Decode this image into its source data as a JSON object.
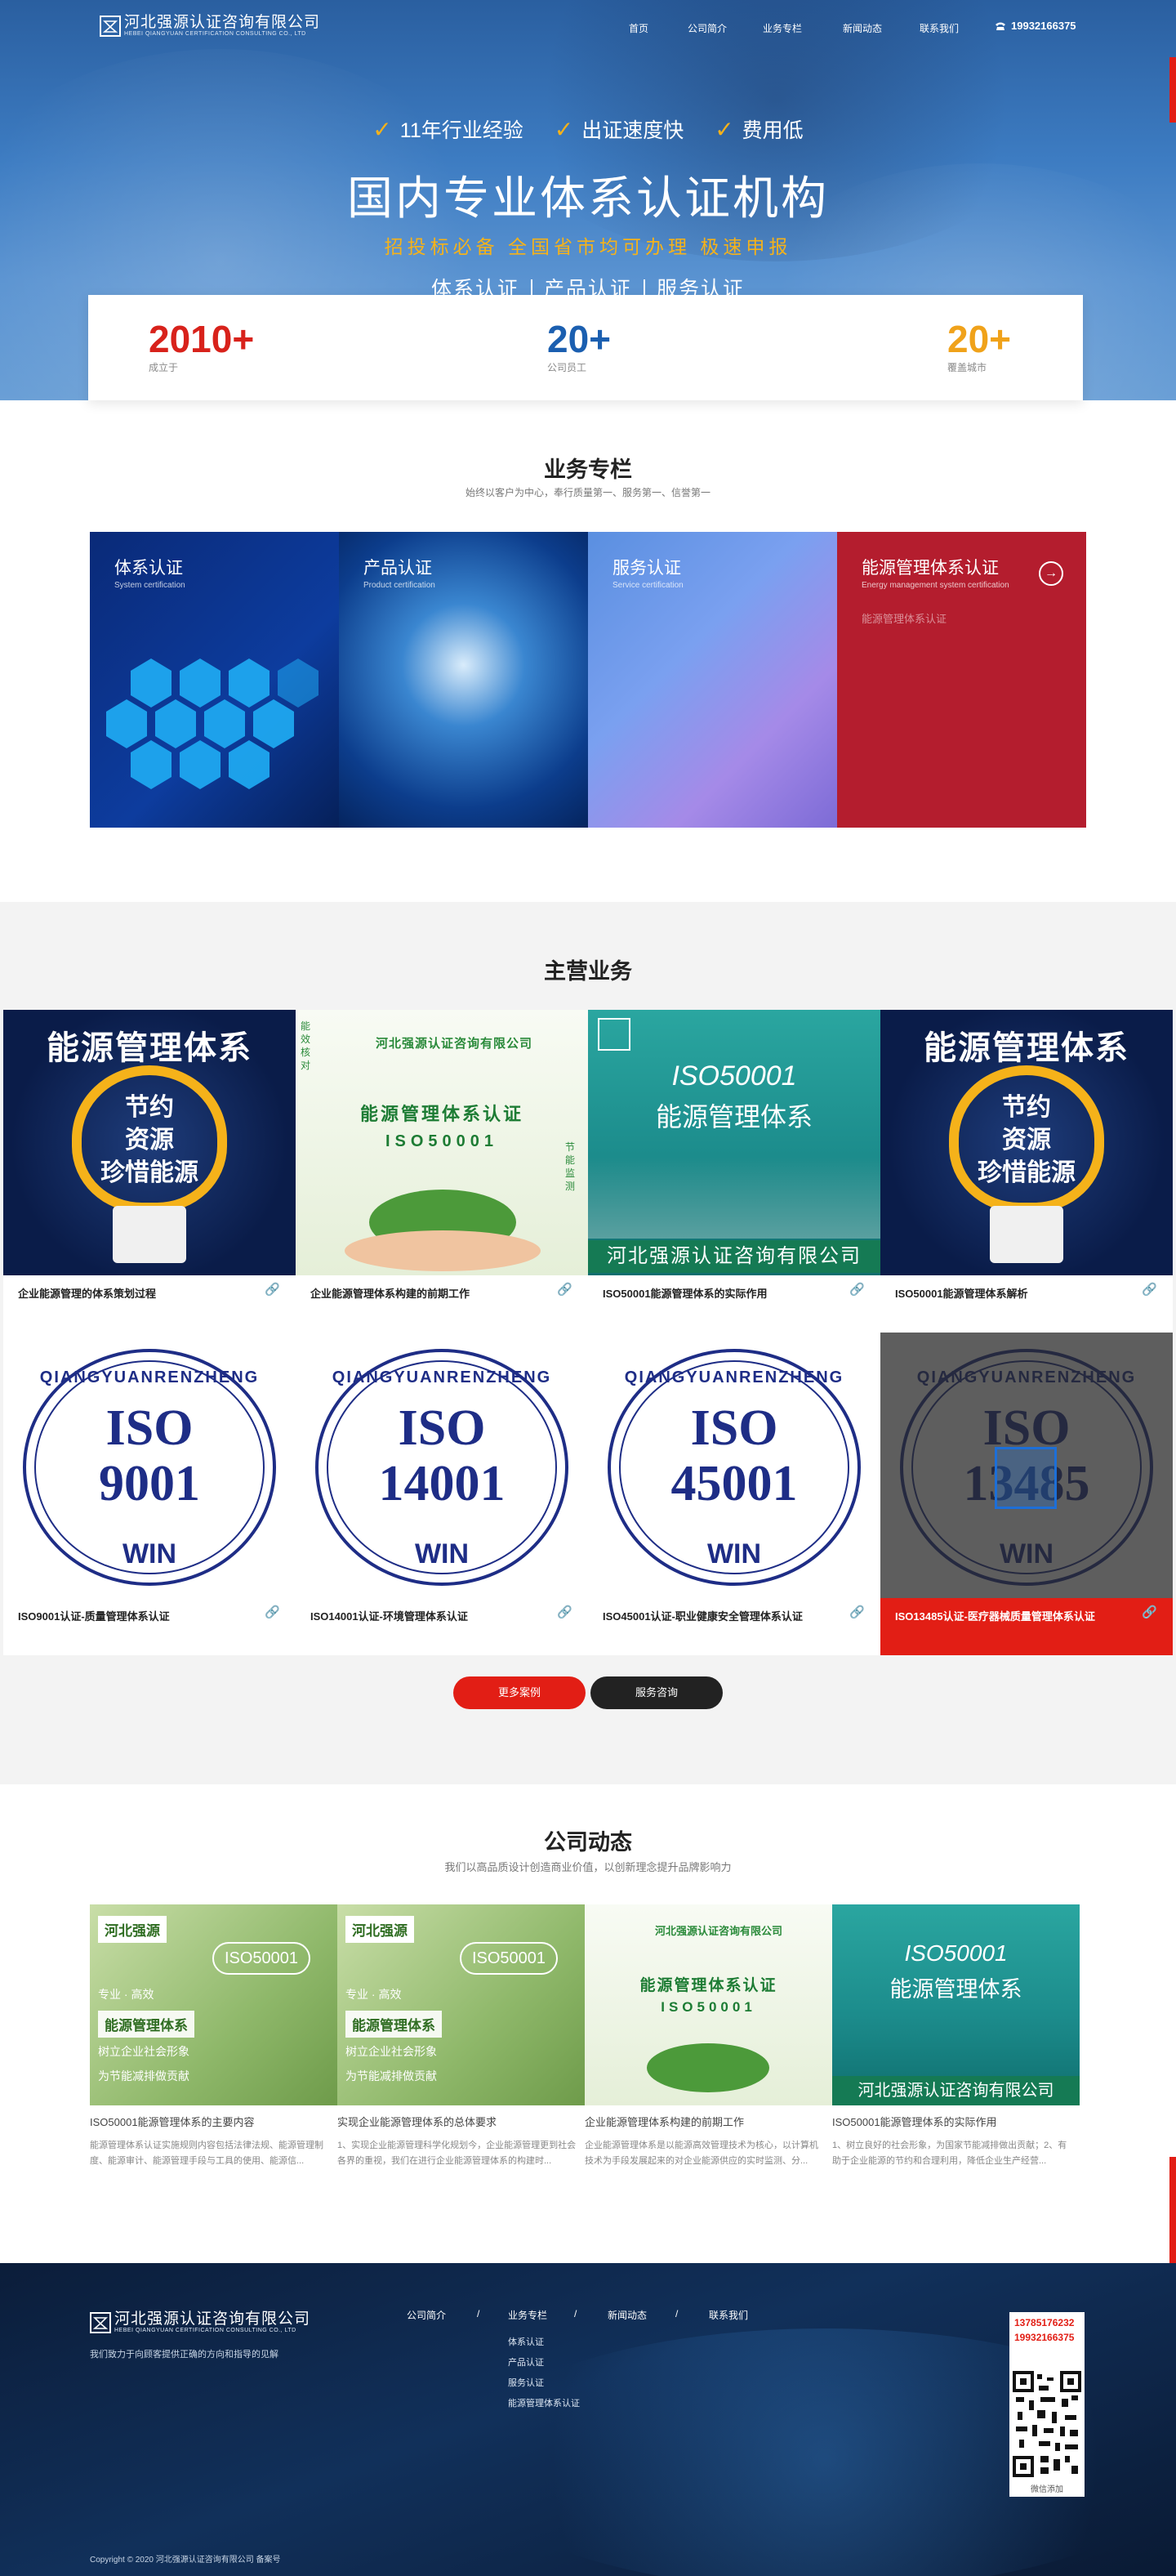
{
  "header": {
    "logo_cn": "河北强源认证咨询有限公司",
    "logo_en": "HEBEI QIANGYUAN CERTIFICATION CONSULTING CO., LTD",
    "nav": [
      "首页",
      "公司简介",
      "业务专栏",
      "新闻动态",
      "联系我们"
    ],
    "phone": "19932166375",
    "phone_icon": "phone-icon"
  },
  "hero": {
    "features": [
      "11年行业经验",
      "出证速度快",
      "费用低"
    ],
    "title": "国内专业体系认证机构",
    "subtitle": "招投标必备  全国省市均可办理  极速申报",
    "cats": [
      "体系认证",
      "产品认证",
      "服务认证"
    ]
  },
  "stats": [
    {
      "num": "2010",
      "plus": "+",
      "label": "成立于",
      "color": "#d8221b"
    },
    {
      "num": "20",
      "plus": "+",
      "label": "公司员工",
      "color": "#1b5fb0"
    },
    {
      "num": "20",
      "plus": "+",
      "label": "覆盖城市",
      "color": "#f0a21a"
    }
  ],
  "business": {
    "title": "业务专栏",
    "subtitle": "始终以客户为中心，奉行质量第一、服务第一、信誉第一",
    "tiles": [
      {
        "title": "体系认证",
        "en": "System certification"
      },
      {
        "title": "产品认证",
        "en": "Product certification"
      },
      {
        "title": "服务认证",
        "en": "Service certification"
      },
      {
        "title": "能源管理体系认证",
        "en": "Energy management system certification",
        "text": "能源管理体系认证"
      }
    ]
  },
  "main": {
    "title": "主营业务",
    "cards": [
      {
        "caption": "企业能源管理的体系策划过程"
      },
      {
        "caption": "企业能源管理体系构建的前期工作"
      },
      {
        "caption": "ISO50001能源管理体系的实际作用"
      },
      {
        "caption": "ISO50001能源管理体系解析"
      },
      {
        "caption": "ISO9001认证-质量管理体系认证"
      },
      {
        "caption": "ISO14001认证-环境管理体系认证"
      },
      {
        "caption": "ISO45001认证-职业健康安全管理体系认证"
      },
      {
        "caption": "ISO13485认证-医疗器械质量管理体系认证"
      }
    ],
    "img_text": {
      "bulb_title": "能源管理体系",
      "bulb_l1": "节约",
      "bulb_l2": "资源",
      "bulb_l3": "珍惜能源",
      "house_company": "河北强源认证咨询有限公司",
      "house_t1": "能源管理体系认证",
      "house_t2": "ISO50001",
      "house_side": "能效核对",
      "house_side2": "节能监测",
      "city_t1": "ISO50001",
      "city_t2": "能源管理体系",
      "city_company": "河北强源认证咨询有限公司",
      "iso_arc": "QIANGYUANRENZHENG",
      "iso_word": "ISO",
      "iso_codes": [
        "9001",
        "14001",
        "45001",
        "13485"
      ],
      "iso_win": "WIN"
    },
    "btn_more": "更多案例",
    "btn_consult": "服务咨询"
  },
  "news": {
    "title": "公司动态",
    "subtitle": "我们以高品质设计创造商业价值，以创新理念提升品牌影响力",
    "items": [
      {
        "title": "ISO50001能源管理体系的主要内容",
        "desc": "能源管理体系认证实施规则内容包括法律法规、能源管理制度、能源审计、能源管理手段与工具的使用、能源信..."
      },
      {
        "title": "实现企业能源管理体系的总体要求",
        "desc": "1、实现企业能源管理科学化规划今，企业能源管理更到社会各界的重视，我们在进行企业能源管理体系的构建时..."
      },
      {
        "title": "企业能源管理体系构建的前期工作",
        "desc": "企业能源管理体系是以能源高效管理技术为核心，以计算机技术为手段发展起来的对企业能源供应的实时监测、分..."
      },
      {
        "title": "ISO50001能源管理体系的实际作用",
        "desc": "1、树立良好的社会形象，为国家节能减排做出贡献；2、有助于企业能源的节约和合理利用，降低企业生产经营..."
      }
    ],
    "img_text": {
      "green_company": "河北强源",
      "green_t1": "ISO50001",
      "green_t2": "专业 · 高效",
      "green_t3": "能源管理体系",
      "green_t4": "树立企业社会形象",
      "green_t5": "为节能减排做贡献"
    }
  },
  "footer": {
    "logo_cn": "河北强源认证咨询有限公司",
    "logo_en": "HEBEI QIANGYUAN CERTIFICATION CONSULTING CO., LTD",
    "slogan": "我们致力于向顾客提供正确的方向和指导的见解",
    "nav": [
      "公司简介",
      "业务专栏",
      "新闻动态",
      "联系我们"
    ],
    "sep": "/",
    "sub": [
      "体系认证",
      "产品认证",
      "服务认证",
      "能源管理体系认证"
    ],
    "phones": [
      "13785176232",
      "19932166375"
    ],
    "qr_label": "微信添加",
    "copyright": "Copyright © 2020 河北强源认证咨询有限公司 备案号"
  }
}
